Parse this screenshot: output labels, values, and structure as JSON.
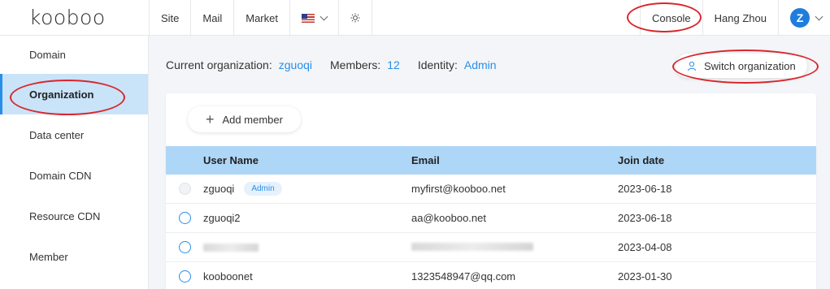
{
  "logo": {
    "text": "kooboo"
  },
  "topnav": {
    "site": "Site",
    "mail": "Mail",
    "market": "Market",
    "language_icon": "us-flag-icon"
  },
  "topright": {
    "console": "Console",
    "region": "Hang Zhou",
    "avatar_initial": "Z"
  },
  "sidebar": {
    "items": [
      {
        "label": "Domain"
      },
      {
        "label": "Organization"
      },
      {
        "label": "Data center"
      },
      {
        "label": "Domain CDN"
      },
      {
        "label": "Resource CDN"
      },
      {
        "label": "Member"
      }
    ]
  },
  "info": {
    "org_label": "Current organization:",
    "org_value": "zguoqi",
    "members_label": "Members:",
    "members_value": "12",
    "identity_label": "Identity:",
    "identity_value": "Admin"
  },
  "switch_button": {
    "label": "Switch organization"
  },
  "add_member": {
    "label": "Add member"
  },
  "table": {
    "headers": {
      "name": "User Name",
      "email": "Email",
      "date": "Join date"
    },
    "rows": [
      {
        "name": "zguoqi",
        "badge": "Admin",
        "email": "myfirst@kooboo.net",
        "date": "2023-06-18"
      },
      {
        "name": "zguoqi2",
        "badge": "",
        "email": "aa@kooboo.net",
        "date": "2023-06-18"
      },
      {
        "name": "",
        "badge": "",
        "email": "",
        "date": "2023-04-08"
      },
      {
        "name": "kooboonet",
        "badge": "",
        "email": "1323548947@qq.com",
        "date": "2023-01-30"
      }
    ]
  },
  "colors": {
    "accent": "#2a8ee8",
    "header_bg": "#aed6f7",
    "active_bg": "#c9e3f8",
    "annotation": "#d9262c"
  }
}
